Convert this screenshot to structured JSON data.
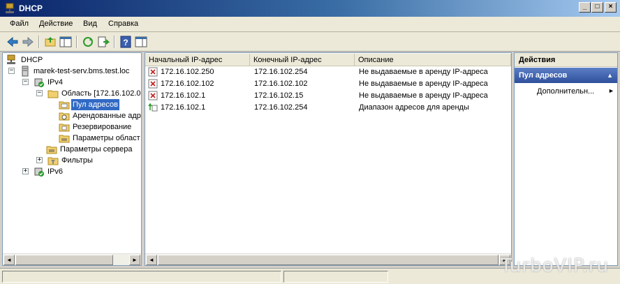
{
  "window": {
    "title": "DHCP",
    "controls": {
      "minimize": "_",
      "maximize": "□",
      "close": "×"
    }
  },
  "menu": [
    "Файл",
    "Действие",
    "Вид",
    "Справка"
  ],
  "toolbar": [
    "back-icon",
    "forward-icon",
    "up-folder-icon",
    "show-hide-tree-icon",
    "refresh-icon",
    "export-list-icon",
    "help-icon",
    "properties-icon"
  ],
  "tree": {
    "root": "DHCP",
    "server": "marek-test-serv.bms.test.loc",
    "ipv4": "IPv4",
    "scope": "Область [172.16.102.0",
    "pool": "Пул адресов",
    "leases": "Арендованные адр",
    "reservations": "Резервирование",
    "scope_options": "Параметры област",
    "server_options": "Параметры сервера",
    "filters": "Фильтры",
    "ipv6": "IPv6"
  },
  "list": {
    "columns": [
      "Начальный IP-адрес",
      "Конечный IP-адрес",
      "Описание"
    ],
    "rows": [
      {
        "start": "172.16.102.250",
        "end": "172.16.102.254",
        "desc": "Не выдаваемые в аренду IP-адреса",
        "icon": "exclusion-icon"
      },
      {
        "start": "172.16.102.102",
        "end": "172.16.102.102",
        "desc": "Не выдаваемые в аренду IP-адреса",
        "icon": "exclusion-icon"
      },
      {
        "start": "172.16.102.1",
        "end": "172.16.102.15",
        "desc": "Не выдаваемые в аренду IP-адреса",
        "icon": "exclusion-icon"
      },
      {
        "start": "172.16.102.1",
        "end": "172.16.102.254",
        "desc": "Диапазон адресов для аренды",
        "icon": "range-icon"
      }
    ]
  },
  "actions": {
    "header": "Действия",
    "section": "Пул адресов",
    "item": "Дополнительн..."
  },
  "watermark": "TurboVIP.ru"
}
